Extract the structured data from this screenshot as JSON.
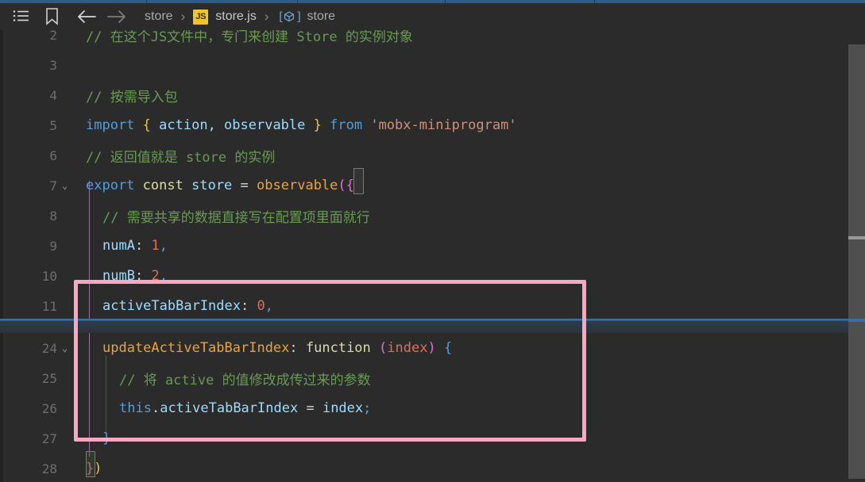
{
  "window": {
    "title": "store.js — Visual Studio Code",
    "theme": "dark"
  },
  "titlebar": {
    "icons": [
      {
        "name": "outline-list-icon",
        "label": "Outline"
      },
      {
        "name": "bookmark-icon",
        "label": "Bookmark"
      },
      {
        "name": "back-arrow-icon",
        "label": "Go Back"
      },
      {
        "name": "forward-arrow-icon",
        "label": "Go Forward"
      }
    ],
    "breadcrumb": {
      "separator": "›",
      "items": [
        {
          "label": "store",
          "kind": "folder"
        },
        {
          "label": "store.js",
          "kind": "file",
          "badge": "JS"
        },
        {
          "label": "store",
          "kind": "symbol"
        }
      ]
    }
  },
  "editor": {
    "language": "javascript",
    "line_height_px": 38,
    "folded_range_label": "12-23",
    "lines": [
      {
        "num": "2",
        "folded_marker": true
      },
      {
        "num": "3"
      },
      {
        "num": "4"
      },
      {
        "num": "5"
      },
      {
        "num": "6"
      },
      {
        "num": "7",
        "fold_chevron": "⌄"
      },
      {
        "num": "8"
      },
      {
        "num": "9"
      },
      {
        "num": "10"
      },
      {
        "num": "11"
      },
      {
        "num": "24",
        "fold_chevron": "⌄"
      },
      {
        "num": "25"
      },
      {
        "num": "26"
      },
      {
        "num": "27"
      },
      {
        "num": "28"
      }
    ],
    "text": {
      "l2": "// 在这个JS文件中，专门来创建 Store 的实例对象",
      "l3": "",
      "l4": "// 按需导入包",
      "l5_import": "import",
      "l5_brace_open": "{",
      "l5_names": " action, observable ",
      "l5_brace_close": "}",
      "l5_from": "from",
      "l5_module": "'mobx-miniprogram'",
      "l6": "// 返回值就是 store 的实例",
      "l7_export": "export",
      "l7_const": "const",
      "l7_name": "store",
      "l7_eq": "=",
      "l7_fn": "observable",
      "l7_paren": "(",
      "l7_brace": "{",
      "l8": "// 需要共享的数据直接写在配置项里面就行",
      "l9_key": "numA",
      "l9_val": "1",
      "l9_comma": ",",
      "l10_key": "numB",
      "l10_val": "2",
      "l10_comma": ",",
      "l11_key": "activeTabBarIndex",
      "l11_val": "0",
      "l11_comma": ",",
      "l24_key": "updateActiveTabBarIndex",
      "l24_fn": "function",
      "l24_paren_open": "(",
      "l24_param": "index",
      "l24_paren_close": ")",
      "l24_brace": "{",
      "l25": "// 将 active 的值修改成传过来的参数",
      "l26_this": "this",
      "l26_dot": ".",
      "l26_prop": "activeTabBarIndex",
      "l26_eq": "=",
      "l26_val": "index",
      "l26_semi": ";",
      "l27": "}",
      "l28_brace": "}",
      "l28_paren": ")"
    }
  },
  "annotation": {
    "name": "pink-highlight-box",
    "color": "#f8a8c0",
    "covers_lines": [
      "11",
      "24",
      "25",
      "26",
      "27"
    ]
  },
  "colors": {
    "background": "#2b2b2b",
    "titlebar": "#2b2b2b",
    "tab_accent": "#2b5c8a",
    "comment": "#6a9955",
    "keyword": "#569cd6",
    "string": "#ce9178",
    "number": "#e06c5a",
    "property": "#9cdcfe",
    "function_name": "#e8a33d",
    "line_number": "#6e6e6e",
    "annotation": "#f8a8c0",
    "fold_band": "#3b6ea5",
    "scrollbar_thumb": "#4f4f4f",
    "js_badge": "#f0c42d"
  },
  "scrollbar": {
    "name": "vertical-scrollbar",
    "marks": [
      "search-match",
      "folded-region"
    ]
  }
}
